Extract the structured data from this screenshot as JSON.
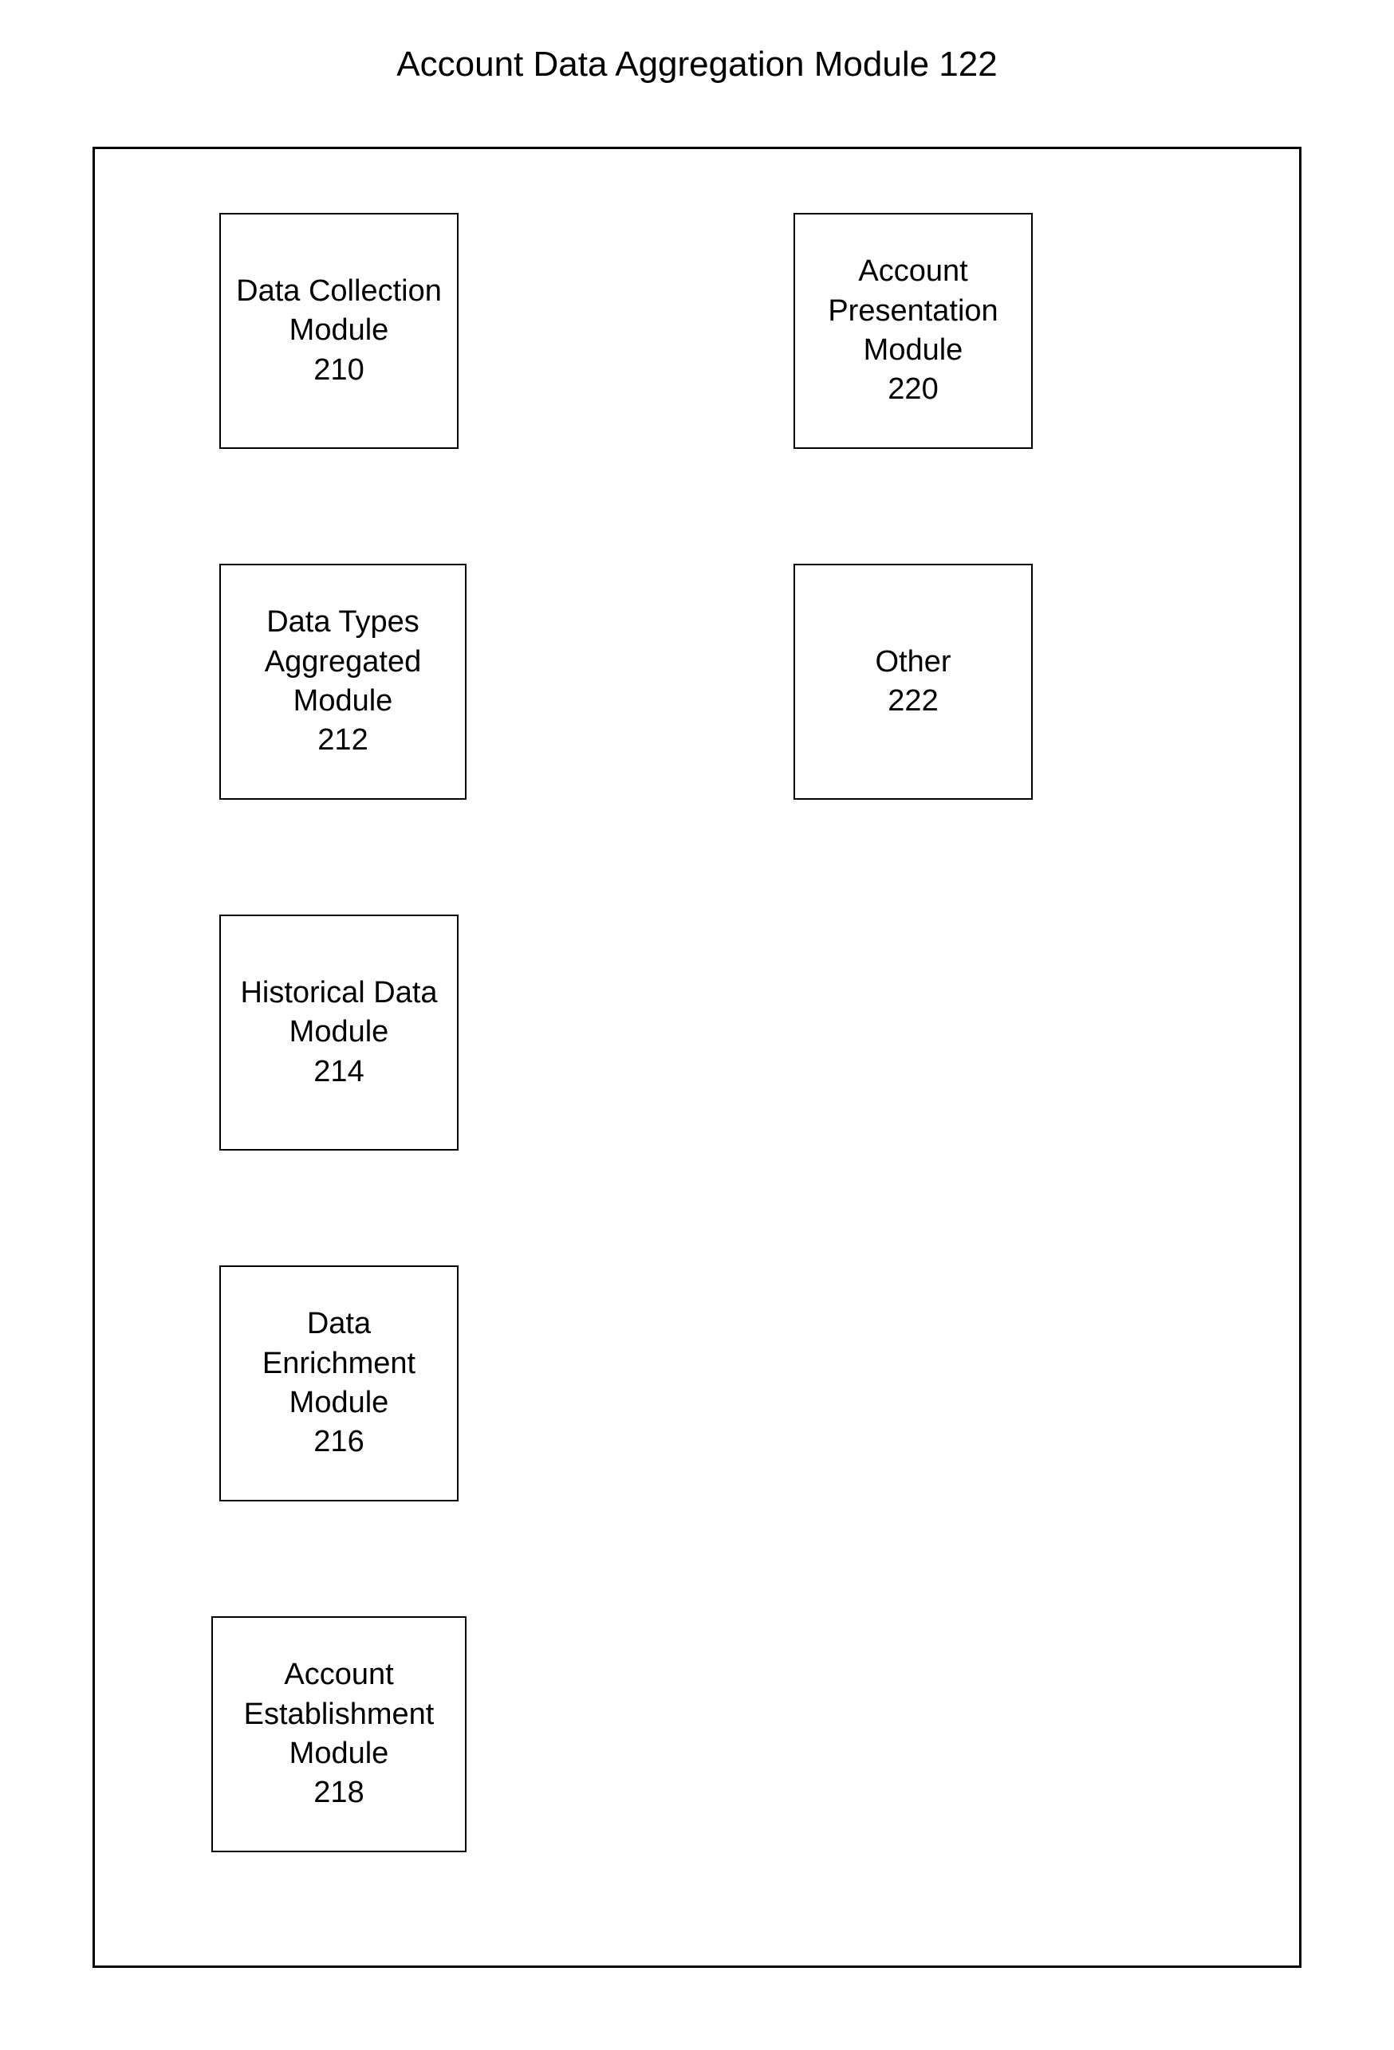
{
  "title": "Account Data Aggregation Module 122",
  "modules": {
    "b210": {
      "label": "Data Collection Module",
      "num": "210"
    },
    "b212": {
      "label": "Data Types Aggregated Module",
      "num": "212"
    },
    "b214": {
      "label": "Historical Data Module",
      "num": "214"
    },
    "b216": {
      "label": "Data Enrichment Module",
      "num": "216"
    },
    "b218": {
      "label": "Account Establishment Module",
      "num": "218"
    },
    "b220": {
      "label": "Account Presentation Module",
      "num": "220"
    },
    "b222": {
      "label": "Other",
      "num": "222"
    }
  }
}
